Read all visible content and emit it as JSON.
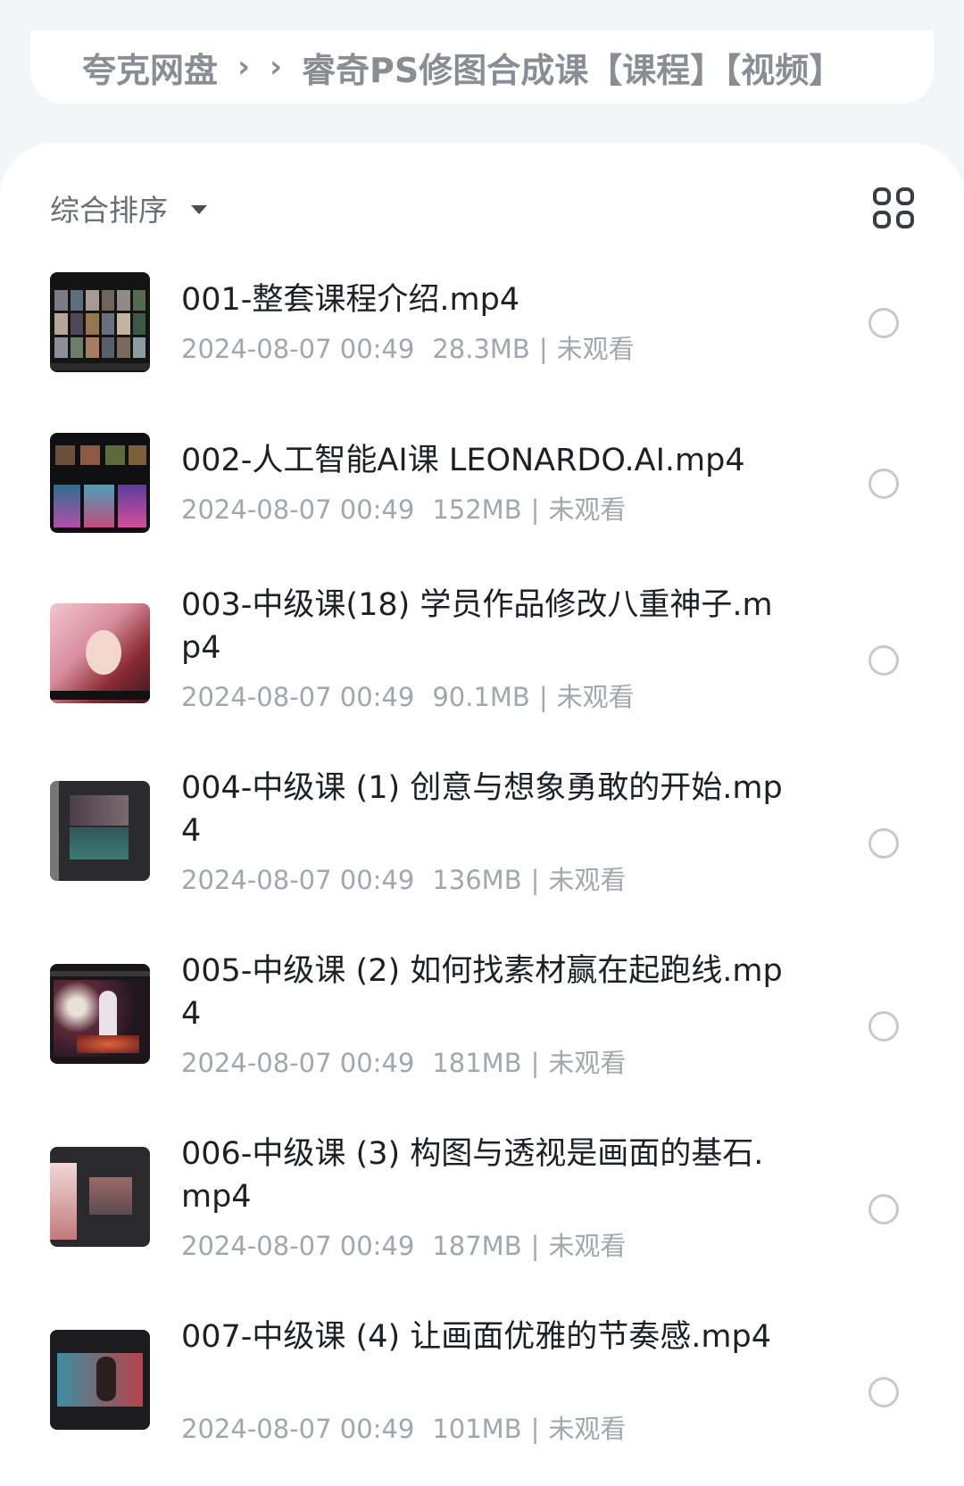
{
  "breadcrumb": {
    "root": "夸克网盘",
    "sep1": "›",
    "sep2": "›",
    "current": "睿奇PS修图合成课【课程】【视频】"
  },
  "toolbar": {
    "sort_label": "综合排序",
    "sort_icon": "caret-down-icon",
    "view_icon": "grid-view-icon"
  },
  "files": [
    {
      "name": "001-整套课程介绍.mp4",
      "time": "2024-08-07 00:49",
      "size": "28.3MB",
      "sep": "|",
      "status": "未观看"
    },
    {
      "name": "002-人工智能AI课 LEONARDO.AI.mp4",
      "time": "2024-08-07 00:49",
      "size": "152MB",
      "sep": "|",
      "status": "未观看"
    },
    {
      "name": "003-中级课(18) 学员作品修改八重神子.mp4",
      "time": "2024-08-07 00:49",
      "size": "90.1MB",
      "sep": "|",
      "status": "未观看"
    },
    {
      "name": "004-中级课 (1) 创意与想象勇敢的开始.mp4",
      "time": "2024-08-07 00:49",
      "size": "136MB",
      "sep": "|",
      "status": "未观看"
    },
    {
      "name": "005-中级课 (2) 如何找素材赢在起跑线.mp4",
      "time": "2024-08-07 00:49",
      "size": "181MB",
      "sep": "|",
      "status": "未观看"
    },
    {
      "name": "006-中级课 (3) 构图与透视是画面的基石.mp4",
      "time": "2024-08-07 00:49",
      "size": "187MB",
      "sep": "|",
      "status": "未观看"
    },
    {
      "name": "007-中级课 (4) 让画面优雅的节奏感.mp4",
      "time": "2024-08-07 00:49",
      "size": "101MB",
      "sep": "|",
      "status": "未观看"
    }
  ],
  "colors": {
    "background": "#f4f5f7",
    "card": "#ffffff",
    "title_text": "#1e2026",
    "meta_text": "#a3a6ad",
    "breadcrumb_text": "#8a8d94"
  }
}
